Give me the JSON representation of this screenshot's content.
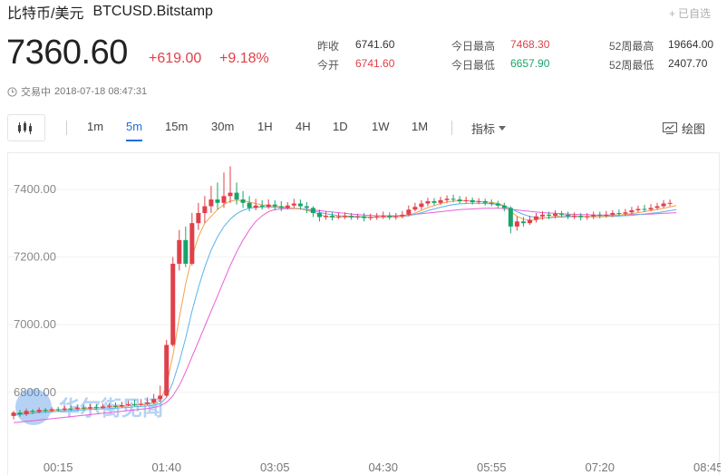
{
  "header": {
    "name": "比特币/美元",
    "symbol": "BTCUSD.Bitstamp",
    "favorite_label": "已自选"
  },
  "quote": {
    "price": "7360.60",
    "change": "+619.00",
    "change_pct": "+9.18%"
  },
  "stats": {
    "prev_close_label": "昨收",
    "prev_close": "6741.60",
    "open_label": "今开",
    "open": "6741.60",
    "high_label": "今日最高",
    "high": "7468.30",
    "low_label": "今日最低",
    "low": "6657.90",
    "w52_high_label": "52周最高",
    "w52_high": "19664.00",
    "w52_low_label": "52周最低",
    "w52_low": "2407.70"
  },
  "status": {
    "state": "交易中",
    "time": "2018-07-18 08:47:31"
  },
  "toolbar": {
    "timeframes": [
      "1m",
      "5m",
      "15m",
      "30m",
      "1H",
      "4H",
      "1D",
      "1W",
      "1M"
    ],
    "active_timeframe": "5m",
    "indicator_label": "指标",
    "draw_label": "绘图"
  },
  "watermark": "华尔街见闻",
  "colors": {
    "up": "#e0404a",
    "down": "#1aa36a",
    "accent": "#1e6fd9",
    "ma_orange": "#f5a04a",
    "ma_blue": "#5ab4ec",
    "ma_pink": "#ea5fd8"
  },
  "chart_data": {
    "type": "candlestick",
    "y_ticks": [
      "7400.00",
      "7200.00",
      "7000.00",
      "6800.00"
    ],
    "y_tick_values": [
      7400,
      7200,
      7000,
      6800
    ],
    "ylim": [
      6660,
      7480
    ],
    "x_ticks": [
      "00:15",
      "01:40",
      "03:05",
      "04:30",
      "05:55",
      "07:20",
      "08:45"
    ],
    "x_tick_index": [
      7,
      24,
      41,
      58,
      75,
      92,
      109
    ],
    "candles": [
      [
        6730,
        6740,
        6720,
        6745
      ],
      [
        6740,
        6735,
        6728,
        6748
      ],
      [
        6735,
        6745,
        6730,
        6752
      ],
      [
        6745,
        6742,
        6735,
        6750
      ],
      [
        6742,
        6748,
        6738,
        6755
      ],
      [
        6748,
        6745,
        6740,
        6754
      ],
      [
        6745,
        6750,
        6741,
        6756
      ],
      [
        6750,
        6748,
        6742,
        6757
      ],
      [
        6748,
        6752,
        6744,
        6759
      ],
      [
        6752,
        6750,
        6745,
        6760
      ],
      [
        6750,
        6755,
        6747,
        6762
      ],
      [
        6755,
        6752,
        6748,
        6763
      ],
      [
        6752,
        6756,
        6749,
        6764
      ],
      [
        6756,
        6754,
        6750,
        6765
      ],
      [
        6754,
        6758,
        6752,
        6766
      ],
      [
        6758,
        6760,
        6754,
        6768
      ],
      [
        6760,
        6758,
        6752,
        6770
      ],
      [
        6758,
        6762,
        6755,
        6772
      ],
      [
        6762,
        6765,
        6758,
        6775
      ],
      [
        6765,
        6763,
        6758,
        6778
      ],
      [
        6763,
        6766,
        6760,
        6780
      ],
      [
        6766,
        6770,
        6762,
        6785
      ],
      [
        6770,
        6780,
        6765,
        6795
      ],
      [
        6780,
        6790,
        6772,
        6820
      ],
      [
        6790,
        6940,
        6785,
        6955
      ],
      [
        6940,
        7180,
        6935,
        7200
      ],
      [
        7180,
        7250,
        7160,
        7280
      ],
      [
        7250,
        7180,
        7170,
        7290
      ],
      [
        7180,
        7300,
        7175,
        7330
      ],
      [
        7300,
        7330,
        7280,
        7360
      ],
      [
        7330,
        7350,
        7300,
        7380
      ],
      [
        7350,
        7370,
        7330,
        7410
      ],
      [
        7370,
        7360,
        7340,
        7420
      ],
      [
        7360,
        7380,
        7345,
        7450
      ],
      [
        7380,
        7390,
        7360,
        7468
      ],
      [
        7390,
        7370,
        7355,
        7420
      ],
      [
        7370,
        7360,
        7345,
        7395
      ],
      [
        7360,
        7345,
        7335,
        7380
      ],
      [
        7345,
        7352,
        7338,
        7372
      ],
      [
        7352,
        7348,
        7340,
        7368
      ],
      [
        7348,
        7355,
        7342,
        7370
      ],
      [
        7355,
        7350,
        7338,
        7368
      ],
      [
        7350,
        7345,
        7335,
        7365
      ],
      [
        7345,
        7352,
        7340,
        7362
      ],
      [
        7352,
        7358,
        7345,
        7372
      ],
      [
        7358,
        7350,
        7340,
        7370
      ],
      [
        7350,
        7345,
        7330,
        7362
      ],
      [
        7345,
        7330,
        7318,
        7350
      ],
      [
        7330,
        7318,
        7305,
        7340
      ],
      [
        7318,
        7322,
        7310,
        7335
      ],
      [
        7322,
        7318,
        7308,
        7332
      ],
      [
        7318,
        7320,
        7312,
        7330
      ],
      [
        7320,
        7322,
        7312,
        7332
      ],
      [
        7322,
        7318,
        7310,
        7330
      ],
      [
        7318,
        7320,
        7310,
        7328
      ],
      [
        7320,
        7315,
        7305,
        7330
      ],
      [
        7315,
        7318,
        7308,
        7328
      ],
      [
        7318,
        7320,
        7310,
        7330
      ],
      [
        7320,
        7322,
        7312,
        7334
      ],
      [
        7322,
        7318,
        7310,
        7332
      ],
      [
        7318,
        7320,
        7310,
        7330
      ],
      [
        7320,
        7325,
        7314,
        7336
      ],
      [
        7325,
        7340,
        7320,
        7352
      ],
      [
        7340,
        7348,
        7335,
        7360
      ],
      [
        7348,
        7358,
        7340,
        7368
      ],
      [
        7358,
        7365,
        7350,
        7375
      ],
      [
        7365,
        7360,
        7352,
        7374
      ],
      [
        7360,
        7368,
        7354,
        7378
      ],
      [
        7368,
        7372,
        7360,
        7382
      ],
      [
        7372,
        7370,
        7362,
        7384
      ],
      [
        7370,
        7365,
        7358,
        7380
      ],
      [
        7365,
        7368,
        7358,
        7378
      ],
      [
        7368,
        7362,
        7355,
        7376
      ],
      [
        7362,
        7365,
        7356,
        7374
      ],
      [
        7365,
        7360,
        7352,
        7372
      ],
      [
        7360,
        7358,
        7350,
        7370
      ],
      [
        7358,
        7352,
        7344,
        7366
      ],
      [
        7352,
        7345,
        7335,
        7360
      ],
      [
        7345,
        7290,
        7270,
        7350
      ],
      [
        7290,
        7305,
        7278,
        7320
      ],
      [
        7305,
        7300,
        7290,
        7318
      ],
      [
        7300,
        7310,
        7295,
        7322
      ],
      [
        7310,
        7320,
        7302,
        7330
      ],
      [
        7320,
        7325,
        7310,
        7335
      ],
      [
        7325,
        7322,
        7312,
        7334
      ],
      [
        7322,
        7328,
        7314,
        7338
      ],
      [
        7328,
        7325,
        7318,
        7336
      ],
      [
        7325,
        7320,
        7312,
        7334
      ],
      [
        7320,
        7322,
        7312,
        7332
      ],
      [
        7322,
        7318,
        7308,
        7330
      ],
      [
        7318,
        7320,
        7310,
        7330
      ],
      [
        7320,
        7325,
        7312,
        7334
      ],
      [
        7325,
        7322,
        7314,
        7334
      ],
      [
        7322,
        7325,
        7316,
        7336
      ],
      [
        7325,
        7330,
        7318,
        7338
      ],
      [
        7330,
        7328,
        7320,
        7340
      ],
      [
        7328,
        7332,
        7322,
        7342
      ],
      [
        7332,
        7338,
        7326,
        7348
      ],
      [
        7338,
        7342,
        7332,
        7352
      ],
      [
        7342,
        7340,
        7334,
        7354
      ],
      [
        7340,
        7345,
        7336,
        7356
      ],
      [
        7345,
        7350,
        7340,
        7360
      ],
      [
        7350,
        7358,
        7345,
        7368
      ],
      [
        7358,
        7360,
        7350,
        7370
      ]
    ],
    "ma_short": [
      6735,
      6738,
      6740,
      6742,
      6744,
      6745,
      6746,
      6748,
      6749,
      6750,
      6751,
      6752,
      6753,
      6754,
      6755,
      6756,
      6757,
      6758,
      6760,
      6762,
      6763,
      6765,
      6768,
      6775,
      6820,
      6910,
      7020,
      7120,
      7200,
      7260,
      7300,
      7320,
      7340,
      7355,
      7365,
      7368,
      7366,
      7362,
      7358,
      7354,
      7352,
      7350,
      7348,
      7346,
      7344,
      7342,
      7338,
      7332,
      7325,
      7320,
      7318,
      7318,
      7318,
      7318,
      7318,
      7317,
      7317,
      7317,
      7318,
      7319,
      7319,
      7320,
      7324,
      7330,
      7338,
      7346,
      7352,
      7358,
      7362,
      7365,
      7366,
      7366,
      7365,
      7364,
      7363,
      7361,
      7358,
      7352,
      7335,
      7320,
      7312,
      7308,
      7310,
      7314,
      7318,
      7320,
      7322,
      7322,
      7321,
      7320,
      7320,
      7320,
      7320,
      7321,
      7322,
      7324,
      7326,
      7328,
      7331,
      7334,
      7337,
      7340,
      7344,
      7348,
      7352
    ],
    "ma_mid": [
      6732,
      6734,
      6736,
      6738,
      6740,
      6741,
      6742,
      6744,
      6745,
      6746,
      6747,
      6748,
      6749,
      6750,
      6751,
      6752,
      6753,
      6754,
      6755,
      6757,
      6758,
      6760,
      6762,
      6766,
      6785,
      6830,
      6890,
      6960,
      7040,
      7110,
      7170,
      7220,
      7260,
      7290,
      7312,
      7328,
      7338,
      7344,
      7347,
      7348,
      7348,
      7347,
      7346,
      7345,
      7344,
      7343,
      7340,
      7336,
      7332,
      7328,
      7325,
      7322,
      7321,
      7320,
      7320,
      7319,
      7318,
      7318,
      7318,
      7318,
      7319,
      7320,
      7322,
      7326,
      7331,
      7337,
      7342,
      7347,
      7351,
      7355,
      7357,
      7358,
      7359,
      7359,
      7358,
      7357,
      7355,
      7351,
      7343,
      7334,
      7326,
      7320,
      7317,
      7316,
      7316,
      7317,
      7318,
      7319,
      7319,
      7319,
      7319,
      7319,
      7319,
      7320,
      7320,
      7321,
      7322,
      7323,
      7325,
      7327,
      7329,
      7331,
      7334,
      7337,
      7340
    ],
    "ma_long": [
      6710,
      6712,
      6714,
      6716,
      6718,
      6720,
      6722,
      6724,
      6726,
      6728,
      6730,
      6732,
      6734,
      6736,
      6738,
      6740,
      6742,
      6744,
      6746,
      6748,
      6750,
      6752,
      6755,
      6760,
      6770,
      6790,
      6820,
      6860,
      6905,
      6950,
      6995,
      7040,
      7085,
      7130,
      7175,
      7215,
      7250,
      7280,
      7305,
      7322,
      7334,
      7340,
      7342,
      7343,
      7343,
      7342,
      7341,
      7339,
      7337,
      7335,
      7333,
      7331,
      7329,
      7327,
      7325,
      7324,
      7323,
      7322,
      7322,
      7322,
      7322,
      7323,
      7324,
      7326,
      7328,
      7330,
      7332,
      7334,
      7336,
      7338,
      7340,
      7341,
      7342,
      7343,
      7344,
      7344,
      7344,
      7343,
      7341,
      7339,
      7337,
      7335,
      7333,
      7331,
      7330,
      7329,
      7328,
      7327,
      7326,
      7325,
      7325,
      7324,
      7324,
      7324,
      7324,
      7324,
      7325,
      7325,
      7326,
      7326,
      7327,
      7328,
      7329,
      7330,
      7331
    ]
  }
}
